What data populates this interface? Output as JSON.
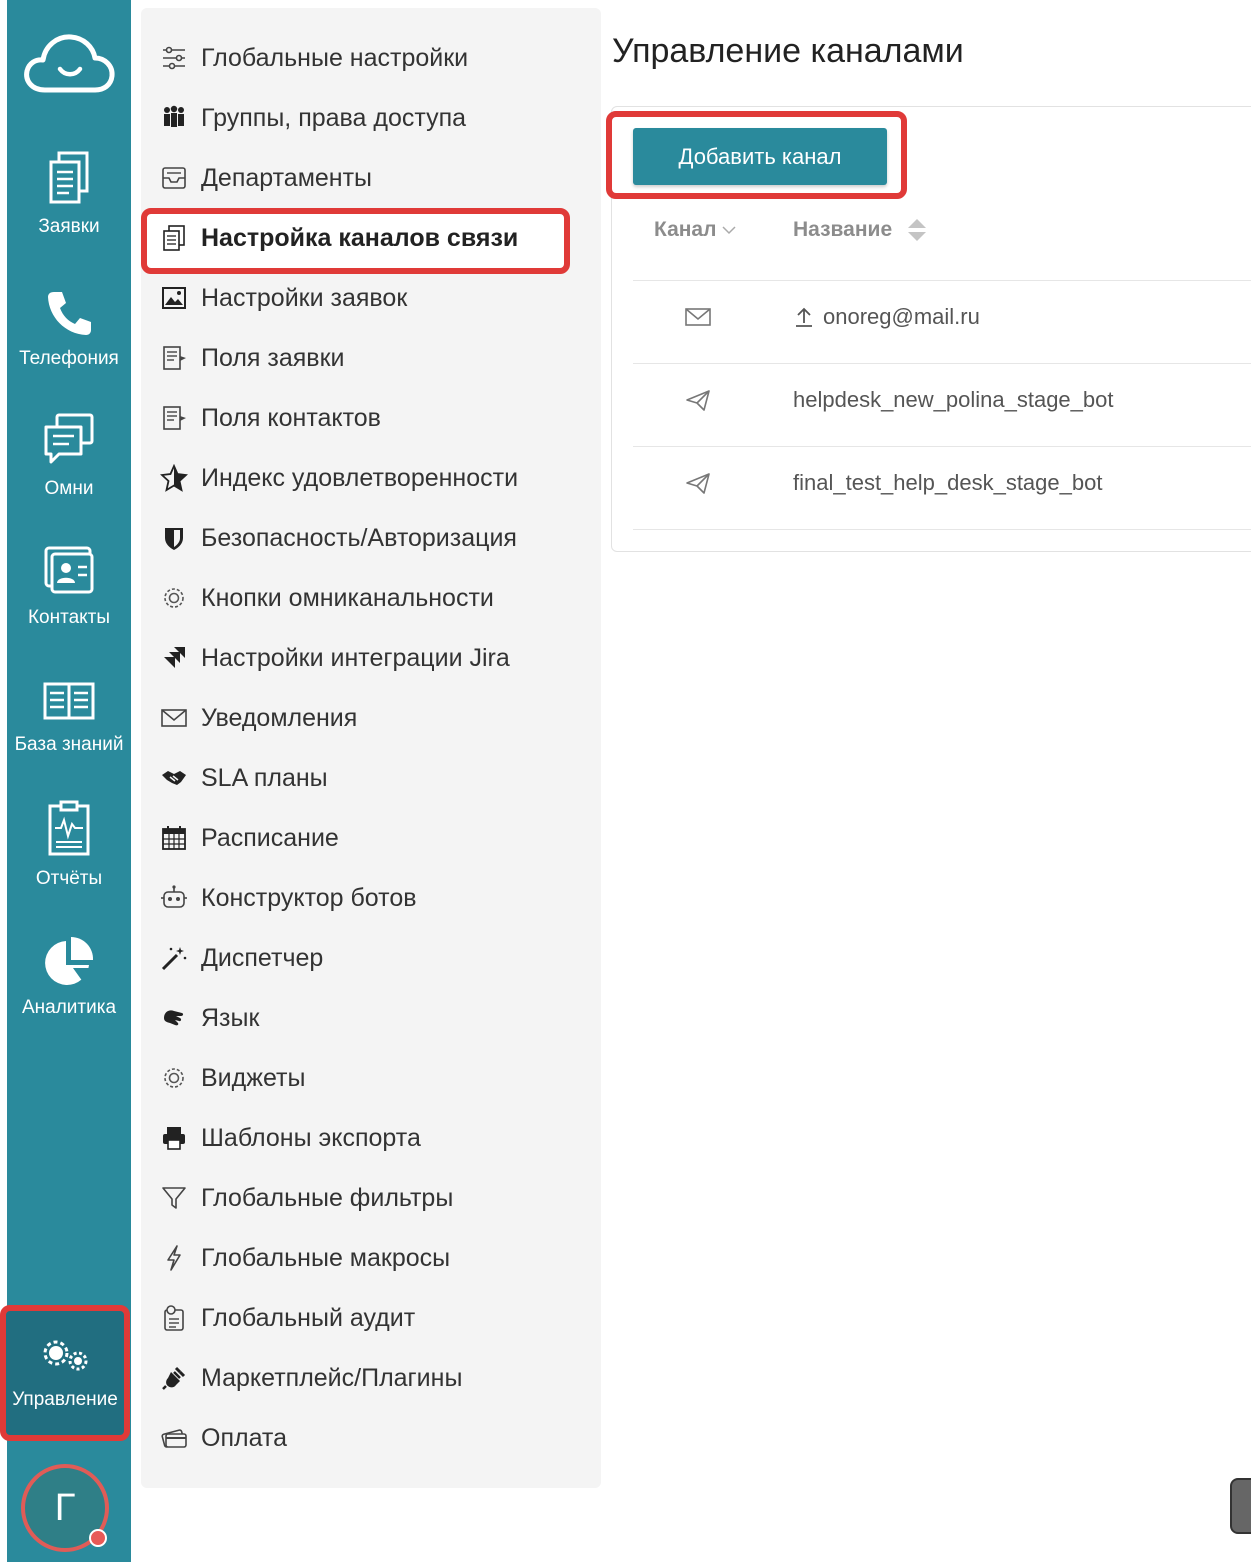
{
  "rail": {
    "items": [
      {
        "label": "Заявки",
        "icon": "documents-icon"
      },
      {
        "label": "Телефония",
        "icon": "phone-icon"
      },
      {
        "label": "Омни",
        "icon": "chat-icon"
      },
      {
        "label": "Контакты",
        "icon": "contact-card-icon"
      },
      {
        "label": "База знаний",
        "icon": "book-icon"
      },
      {
        "label": "Отчёты",
        "icon": "report-icon"
      },
      {
        "label": "Аналитика",
        "icon": "pie-chart-icon"
      }
    ],
    "manage_label": "Управление",
    "avatar_letter": "Г"
  },
  "menu": {
    "items": [
      {
        "label": "Глобальные настройки",
        "icon": "sliders-icon"
      },
      {
        "label": "Группы, права доступа",
        "icon": "users-icon"
      },
      {
        "label": "Департаменты",
        "icon": "inbox-icon"
      },
      {
        "label": "Настройка каналов связи",
        "icon": "copy-icon",
        "active": true
      },
      {
        "label": "Настройки заявок",
        "icon": "image-icon"
      },
      {
        "label": "Поля заявки",
        "icon": "form-icon"
      },
      {
        "label": "Поля контактов",
        "icon": "form-icon"
      },
      {
        "label": "Индекс удовлетворенности",
        "icon": "star-icon"
      },
      {
        "label": "Безопасность/Авторизация",
        "icon": "shield-icon"
      },
      {
        "label": "Кнопки омниканальности",
        "icon": "gear-icon"
      },
      {
        "label": "Настройки интеграции Jira",
        "icon": "jira-icon"
      },
      {
        "label": "Уведомления",
        "icon": "envelope-icon"
      },
      {
        "label": "SLA планы",
        "icon": "handshake-icon"
      },
      {
        "label": "Расписание",
        "icon": "calendar-icon"
      },
      {
        "label": "Конструктор ботов",
        "icon": "robot-icon"
      },
      {
        "label": "Диспетчер",
        "icon": "magic-wand-icon"
      },
      {
        "label": "Язык",
        "icon": "sign-language-icon"
      },
      {
        "label": "Виджеты",
        "icon": "gear-icon"
      },
      {
        "label": "Шаблоны экспорта",
        "icon": "printer-icon"
      },
      {
        "label": "Глобальные фильтры",
        "icon": "filter-icon"
      },
      {
        "label": "Глобальные макросы",
        "icon": "bolt-icon"
      },
      {
        "label": "Глобальный аудит",
        "icon": "audit-icon"
      },
      {
        "label": "Маркетплейс/Плагины",
        "icon": "plug-icon"
      },
      {
        "label": "Оплата",
        "icon": "credit-card-icon"
      }
    ]
  },
  "main": {
    "title": "Управление каналами",
    "add_button": "Добавить канал",
    "columns": {
      "channel": "Канал",
      "name": "Название"
    },
    "rows": [
      {
        "type": "email",
        "icon": "envelope-icon",
        "prefix_icon": "upload-icon",
        "name": "onoreg@mail.ru"
      },
      {
        "type": "telegram",
        "icon": "paper-plane-icon",
        "name": "helpdesk_new_polina_stage_bot"
      },
      {
        "type": "telegram",
        "icon": "paper-plane-icon",
        "name": "final_test_help_desk_stage_bot"
      }
    ]
  },
  "colors": {
    "brand": "#2a8a9c",
    "highlight": "#e03a38",
    "menu_bg": "#f4f4f4"
  }
}
